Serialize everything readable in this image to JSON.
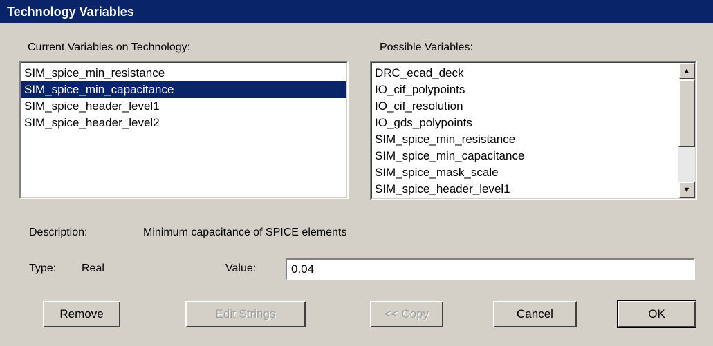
{
  "window": {
    "title": "Technology Variables"
  },
  "current": {
    "label": "Current Variables on Technology:",
    "items": [
      "SIM_spice_min_resistance",
      "SIM_spice_min_capacitance",
      "SIM_spice_header_level1",
      "SIM_spice_header_level2"
    ],
    "selected_index": 1
  },
  "possible": {
    "label": "Possible Variables:",
    "items": [
      "DRC_ecad_deck",
      "IO_cif_polypoints",
      "IO_cif_resolution",
      "IO_gds_polypoints",
      "SIM_spice_min_resistance",
      "SIM_spice_min_capacitance",
      "SIM_spice_mask_scale",
      "SIM_spice_header_level1"
    ]
  },
  "description": {
    "label": "Description:",
    "value": "Minimum capacitance of SPICE elements"
  },
  "type": {
    "label": "Type:",
    "value": "Real"
  },
  "value_field": {
    "label": "Value:",
    "value": "0.04"
  },
  "buttons": {
    "remove": "Remove",
    "edit_strings": "Edit Strings",
    "copy": "<< Copy",
    "cancel": "Cancel",
    "ok": "OK"
  },
  "icons": {
    "scroll_up": "scroll-up-arrow-icon",
    "scroll_down": "scroll-down-arrow-icon"
  }
}
